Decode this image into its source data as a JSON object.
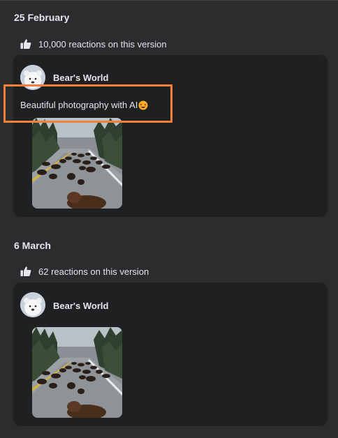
{
  "versions": [
    {
      "date": "25 February",
      "reactions": "10,000 reactions on this version",
      "author": "Bear's World",
      "caption": "Beautiful photography with AI"
    },
    {
      "date": "6 March",
      "reactions": "62 reactions on this version",
      "author": "Bear's World",
      "caption": ""
    }
  ],
  "colors": {
    "background": "#2b2c2e",
    "card": "#1f2021",
    "highlight": "#f0803c",
    "text": "#e4e6eb"
  },
  "icons": {
    "reaction": "thumbs-up-icon",
    "caption_emoji": "star-struck-emoji-icon",
    "avatar": "polar-bear-avatar"
  }
}
